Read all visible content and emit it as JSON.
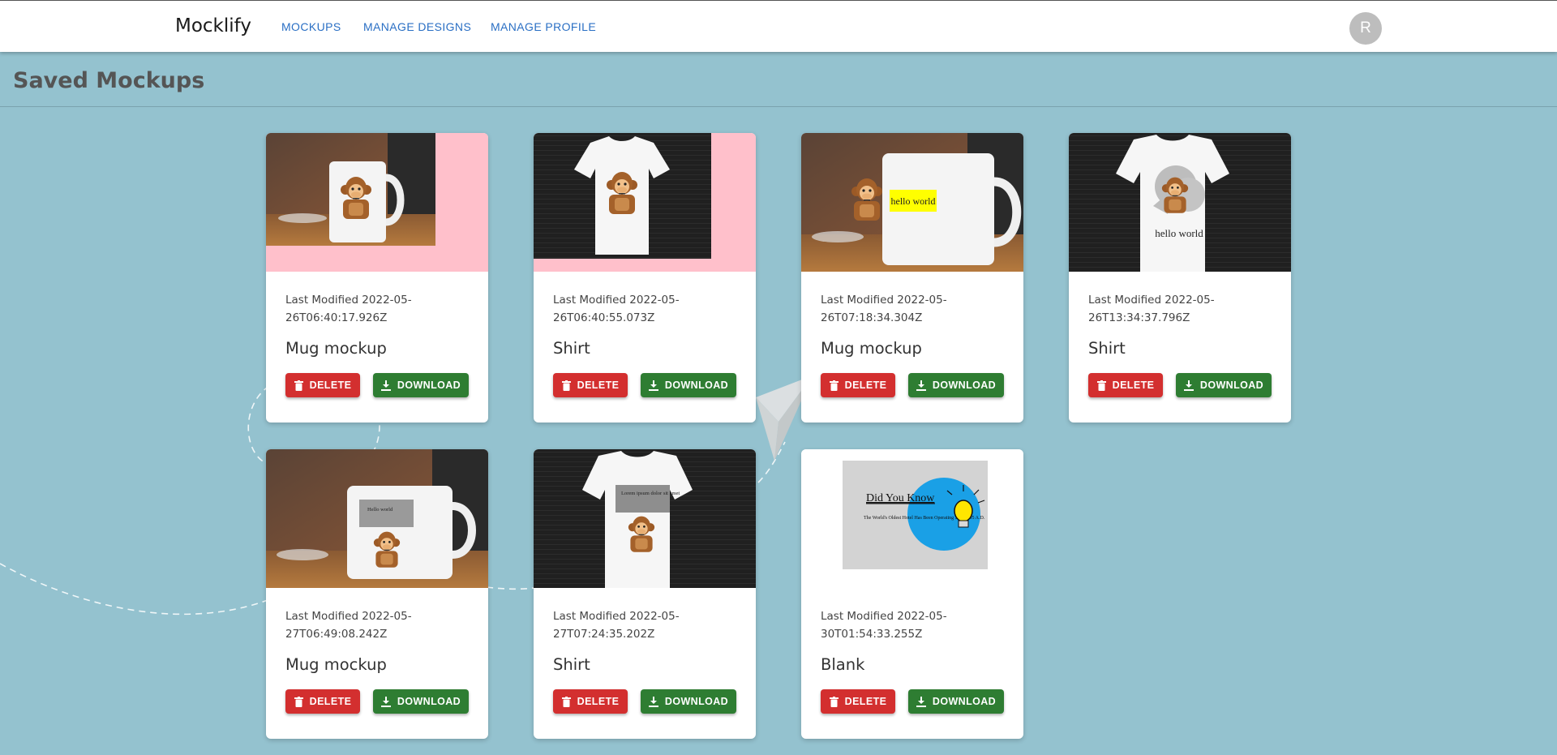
{
  "app": {
    "brand": "Mocklify"
  },
  "nav": {
    "links": [
      "MOCKUPS",
      "MANAGE DESIGNS",
      "MANAGE PROFILE"
    ],
    "avatar": "R"
  },
  "page": {
    "title": "Saved Mockups"
  },
  "buttons": {
    "delete": "DELETE",
    "download": "DOWNLOAD"
  },
  "colors": {
    "background": "#94c2cf",
    "delete": "#d32f2f",
    "download": "#2e7d32",
    "link": "#2a6fc4",
    "pink": "#ffc0cb"
  },
  "mockups": [
    {
      "label": "Last Modified 2022-05-26T06:40:17.926Z",
      "title": "Mug mockup"
    },
    {
      "label": "Last Modified 2022-05-26T06:40:55.073Z",
      "title": "Shirt"
    },
    {
      "label": "Last Modified 2022-05-26T07:18:34.304Z",
      "title": "Mug mockup"
    },
    {
      "label": "Last Modified 2022-05-26T13:34:37.796Z",
      "title": "Shirt"
    },
    {
      "label": "Last Modified 2022-05-27T06:49:08.242Z",
      "title": "Mug mockup"
    },
    {
      "label": "Last Modified 2022-05-27T07:24:35.202Z",
      "title": "Shirt"
    },
    {
      "label": "Last Modified 2022-05-30T01:54:33.255Z",
      "title": "Blank"
    }
  ],
  "image_text": {
    "hello": "hello world",
    "hello_cap": "Hello world",
    "lorem": "Lorem ipsum dolor sit amet",
    "did_you_know": "Did You Know",
    "fact": "The World's Oldest Hotel Has Been Operating Since 705 A.D."
  }
}
